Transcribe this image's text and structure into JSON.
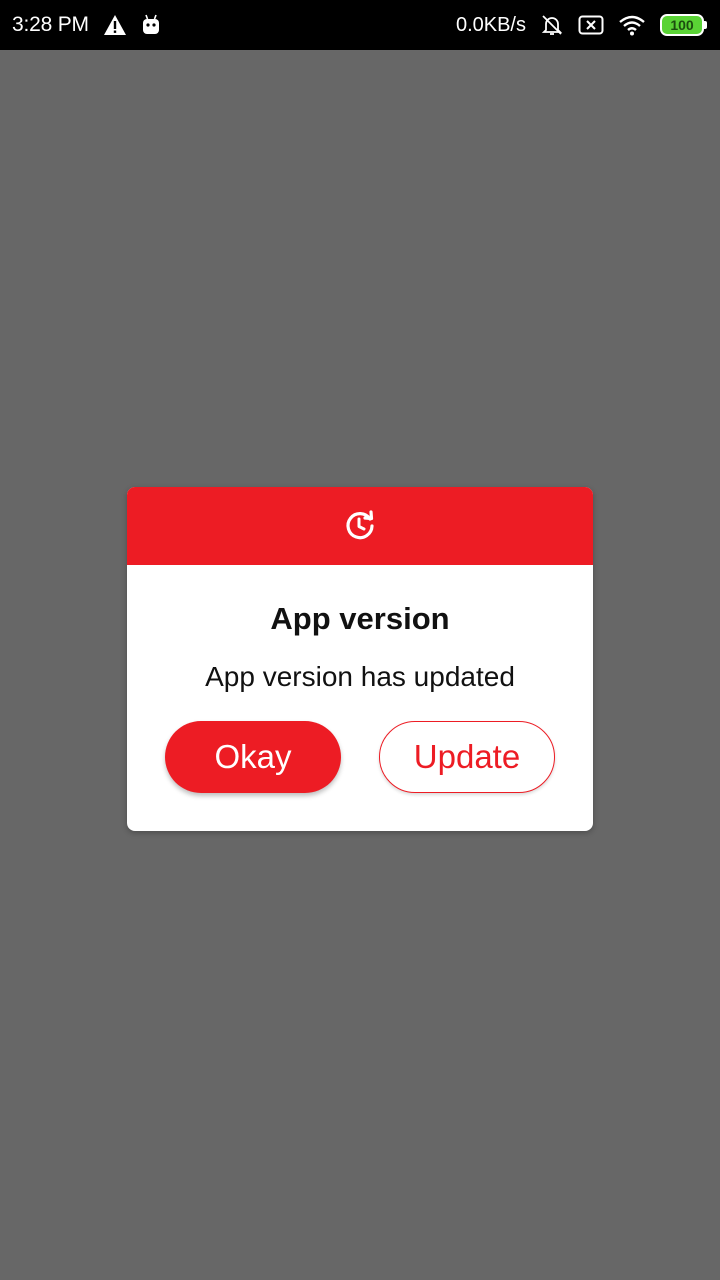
{
  "status_bar": {
    "time": "3:28 PM",
    "network_speed": "0.0KB/s",
    "battery_level": "100",
    "icons": [
      "warning-icon",
      "android-icon",
      "bell-muted-icon",
      "sim-none-icon",
      "wifi-icon",
      "battery-icon"
    ]
  },
  "dialog": {
    "header_icon": "update-history-icon",
    "title": "App version",
    "message": "App version has updated",
    "okay_label": "Okay",
    "update_label": "Update"
  },
  "colors": {
    "accent": "#ed1c24",
    "scrim": "#676767",
    "battery": "#5ad335"
  }
}
